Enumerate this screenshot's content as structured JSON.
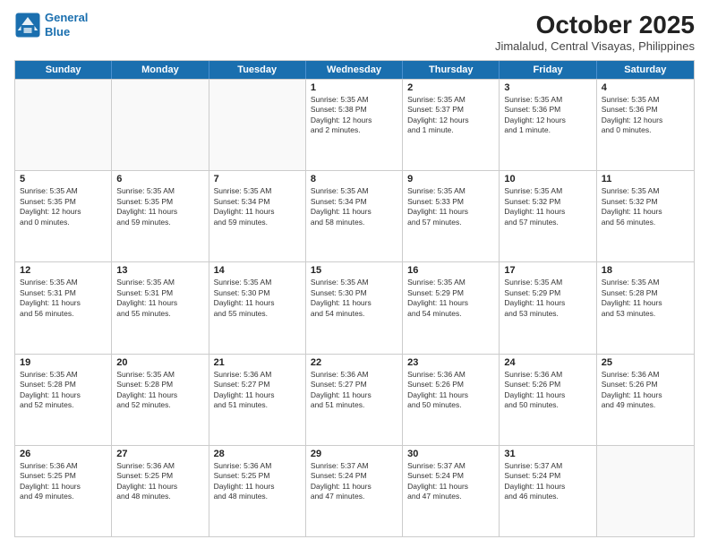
{
  "logo": {
    "line1": "General",
    "line2": "Blue"
  },
  "title": "October 2025",
  "subtitle": "Jimalalud, Central Visayas, Philippines",
  "header_days": [
    "Sunday",
    "Monday",
    "Tuesday",
    "Wednesday",
    "Thursday",
    "Friday",
    "Saturday"
  ],
  "weeks": [
    [
      {
        "day": "",
        "lines": []
      },
      {
        "day": "",
        "lines": []
      },
      {
        "day": "",
        "lines": []
      },
      {
        "day": "1",
        "lines": [
          "Sunrise: 5:35 AM",
          "Sunset: 5:38 PM",
          "Daylight: 12 hours",
          "and 2 minutes."
        ]
      },
      {
        "day": "2",
        "lines": [
          "Sunrise: 5:35 AM",
          "Sunset: 5:37 PM",
          "Daylight: 12 hours",
          "and 1 minute."
        ]
      },
      {
        "day": "3",
        "lines": [
          "Sunrise: 5:35 AM",
          "Sunset: 5:36 PM",
          "Daylight: 12 hours",
          "and 1 minute."
        ]
      },
      {
        "day": "4",
        "lines": [
          "Sunrise: 5:35 AM",
          "Sunset: 5:36 PM",
          "Daylight: 12 hours",
          "and 0 minutes."
        ]
      }
    ],
    [
      {
        "day": "5",
        "lines": [
          "Sunrise: 5:35 AM",
          "Sunset: 5:35 PM",
          "Daylight: 12 hours",
          "and 0 minutes."
        ]
      },
      {
        "day": "6",
        "lines": [
          "Sunrise: 5:35 AM",
          "Sunset: 5:35 PM",
          "Daylight: 11 hours",
          "and 59 minutes."
        ]
      },
      {
        "day": "7",
        "lines": [
          "Sunrise: 5:35 AM",
          "Sunset: 5:34 PM",
          "Daylight: 11 hours",
          "and 59 minutes."
        ]
      },
      {
        "day": "8",
        "lines": [
          "Sunrise: 5:35 AM",
          "Sunset: 5:34 PM",
          "Daylight: 11 hours",
          "and 58 minutes."
        ]
      },
      {
        "day": "9",
        "lines": [
          "Sunrise: 5:35 AM",
          "Sunset: 5:33 PM",
          "Daylight: 11 hours",
          "and 57 minutes."
        ]
      },
      {
        "day": "10",
        "lines": [
          "Sunrise: 5:35 AM",
          "Sunset: 5:32 PM",
          "Daylight: 11 hours",
          "and 57 minutes."
        ]
      },
      {
        "day": "11",
        "lines": [
          "Sunrise: 5:35 AM",
          "Sunset: 5:32 PM",
          "Daylight: 11 hours",
          "and 56 minutes."
        ]
      }
    ],
    [
      {
        "day": "12",
        "lines": [
          "Sunrise: 5:35 AM",
          "Sunset: 5:31 PM",
          "Daylight: 11 hours",
          "and 56 minutes."
        ]
      },
      {
        "day": "13",
        "lines": [
          "Sunrise: 5:35 AM",
          "Sunset: 5:31 PM",
          "Daylight: 11 hours",
          "and 55 minutes."
        ]
      },
      {
        "day": "14",
        "lines": [
          "Sunrise: 5:35 AM",
          "Sunset: 5:30 PM",
          "Daylight: 11 hours",
          "and 55 minutes."
        ]
      },
      {
        "day": "15",
        "lines": [
          "Sunrise: 5:35 AM",
          "Sunset: 5:30 PM",
          "Daylight: 11 hours",
          "and 54 minutes."
        ]
      },
      {
        "day": "16",
        "lines": [
          "Sunrise: 5:35 AM",
          "Sunset: 5:29 PM",
          "Daylight: 11 hours",
          "and 54 minutes."
        ]
      },
      {
        "day": "17",
        "lines": [
          "Sunrise: 5:35 AM",
          "Sunset: 5:29 PM",
          "Daylight: 11 hours",
          "and 53 minutes."
        ]
      },
      {
        "day": "18",
        "lines": [
          "Sunrise: 5:35 AM",
          "Sunset: 5:28 PM",
          "Daylight: 11 hours",
          "and 53 minutes."
        ]
      }
    ],
    [
      {
        "day": "19",
        "lines": [
          "Sunrise: 5:35 AM",
          "Sunset: 5:28 PM",
          "Daylight: 11 hours",
          "and 52 minutes."
        ]
      },
      {
        "day": "20",
        "lines": [
          "Sunrise: 5:35 AM",
          "Sunset: 5:28 PM",
          "Daylight: 11 hours",
          "and 52 minutes."
        ]
      },
      {
        "day": "21",
        "lines": [
          "Sunrise: 5:36 AM",
          "Sunset: 5:27 PM",
          "Daylight: 11 hours",
          "and 51 minutes."
        ]
      },
      {
        "day": "22",
        "lines": [
          "Sunrise: 5:36 AM",
          "Sunset: 5:27 PM",
          "Daylight: 11 hours",
          "and 51 minutes."
        ]
      },
      {
        "day": "23",
        "lines": [
          "Sunrise: 5:36 AM",
          "Sunset: 5:26 PM",
          "Daylight: 11 hours",
          "and 50 minutes."
        ]
      },
      {
        "day": "24",
        "lines": [
          "Sunrise: 5:36 AM",
          "Sunset: 5:26 PM",
          "Daylight: 11 hours",
          "and 50 minutes."
        ]
      },
      {
        "day": "25",
        "lines": [
          "Sunrise: 5:36 AM",
          "Sunset: 5:26 PM",
          "Daylight: 11 hours",
          "and 49 minutes."
        ]
      }
    ],
    [
      {
        "day": "26",
        "lines": [
          "Sunrise: 5:36 AM",
          "Sunset: 5:25 PM",
          "Daylight: 11 hours",
          "and 49 minutes."
        ]
      },
      {
        "day": "27",
        "lines": [
          "Sunrise: 5:36 AM",
          "Sunset: 5:25 PM",
          "Daylight: 11 hours",
          "and 48 minutes."
        ]
      },
      {
        "day": "28",
        "lines": [
          "Sunrise: 5:36 AM",
          "Sunset: 5:25 PM",
          "Daylight: 11 hours",
          "and 48 minutes."
        ]
      },
      {
        "day": "29",
        "lines": [
          "Sunrise: 5:37 AM",
          "Sunset: 5:24 PM",
          "Daylight: 11 hours",
          "and 47 minutes."
        ]
      },
      {
        "day": "30",
        "lines": [
          "Sunrise: 5:37 AM",
          "Sunset: 5:24 PM",
          "Daylight: 11 hours",
          "and 47 minutes."
        ]
      },
      {
        "day": "31",
        "lines": [
          "Sunrise: 5:37 AM",
          "Sunset: 5:24 PM",
          "Daylight: 11 hours",
          "and 46 minutes."
        ]
      },
      {
        "day": "",
        "lines": []
      }
    ]
  ]
}
